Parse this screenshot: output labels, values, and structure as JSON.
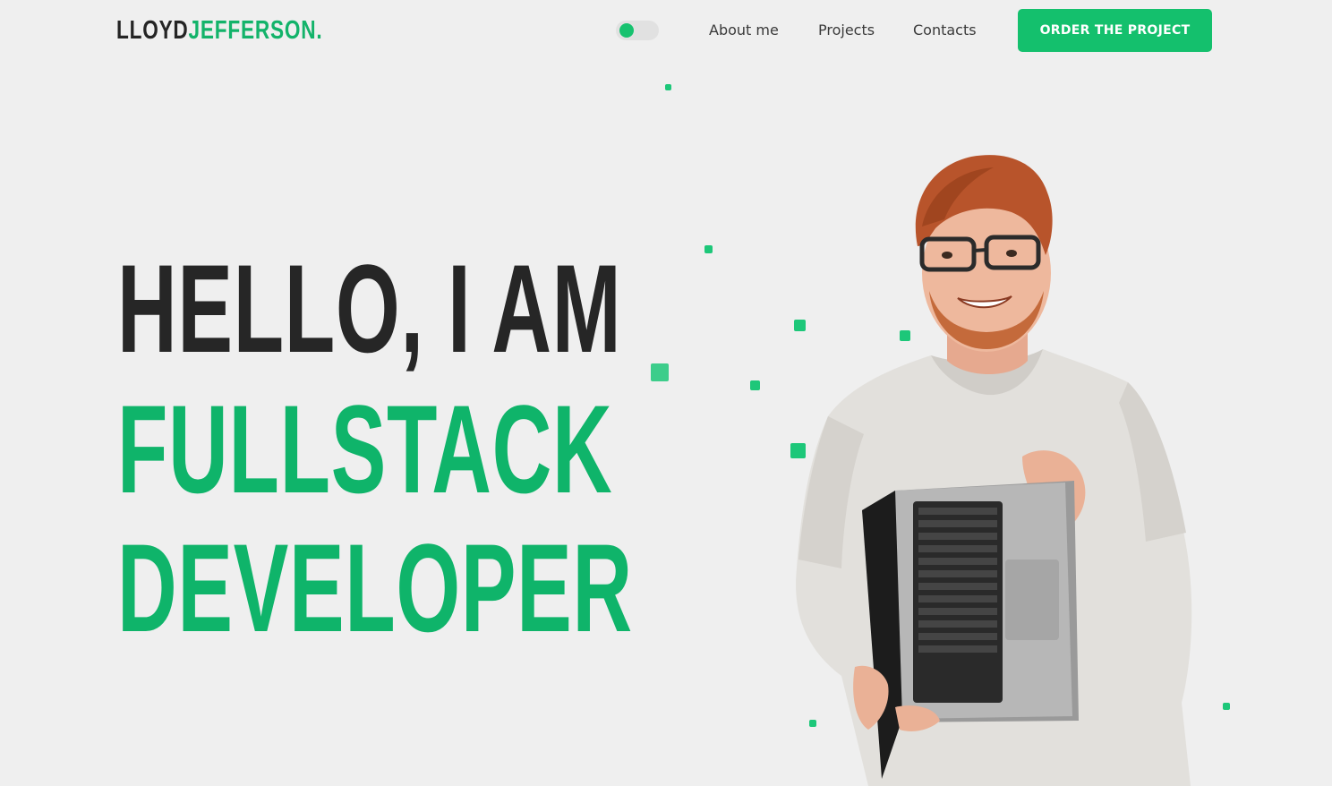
{
  "header": {
    "logo_first": "LLOYD",
    "logo_last": "JEFFERSON.",
    "nav": [
      {
        "label": "About me"
      },
      {
        "label": "Projects"
      },
      {
        "label": "Contacts"
      }
    ],
    "cta_label": "ORDER THE PROJECT"
  },
  "hero": {
    "line1": "HELLO, I AM",
    "line2": "FULLSTACK",
    "line3": "DEVELOPER"
  },
  "colors": {
    "accent": "#14c06d",
    "dark": "#262626",
    "background": "#efefef"
  },
  "icons": [
    "theme-toggle-icon"
  ]
}
